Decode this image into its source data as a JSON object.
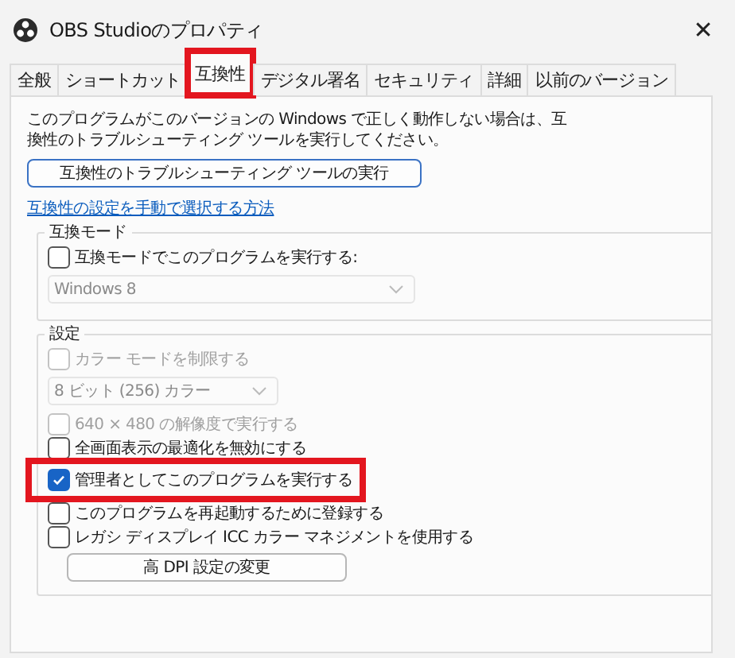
{
  "window": {
    "title": "OBS Studioのプロパティ",
    "close": "✕"
  },
  "tabs": [
    {
      "label": "全般",
      "selected": false,
      "highlighted": false
    },
    {
      "label": "ショートカット",
      "selected": false,
      "highlighted": false
    },
    {
      "label": "互換性",
      "selected": true,
      "highlighted": true
    },
    {
      "label": "デジタル署名",
      "selected": false,
      "highlighted": false
    },
    {
      "label": "セキュリティ",
      "selected": false,
      "highlighted": false
    },
    {
      "label": "詳細",
      "selected": false,
      "highlighted": false
    },
    {
      "label": "以前のバージョン",
      "selected": false,
      "highlighted": false
    }
  ],
  "intro": "このプログラムがこのバージョンの Windows で正しく動作しない場合は、互換性のトラブルシューティング ツールを実行してください。",
  "troubleshoot_button": "互換性のトラブルシューティング ツールの実行",
  "help_link": "互換性の設定を手動で選択する方法",
  "compat_mode": {
    "title": "互換モード",
    "items": [
      {
        "kind": "checkbox",
        "label": "互換モードでこのプログラムを実行する:",
        "checked": false,
        "disabled": false,
        "highlighted": false
      },
      {
        "kind": "dropdown",
        "value": "Windows 8",
        "disabled": true
      }
    ]
  },
  "settings": {
    "title": "設定",
    "items": [
      {
        "kind": "checkbox",
        "label": "カラー モードを制限する",
        "checked": false,
        "disabled": true,
        "highlighted": false
      },
      {
        "kind": "dropdown",
        "value": "8 ビット (256) カラー",
        "disabled": true
      },
      {
        "kind": "checkbox",
        "label": "640 × 480 の解像度で実行する",
        "checked": false,
        "disabled": true,
        "highlighted": false
      },
      {
        "kind": "checkbox",
        "label": "全画面表示の最適化を無効にする",
        "checked": false,
        "disabled": false,
        "highlighted": false
      },
      {
        "kind": "checkbox",
        "label": "管理者としてこのプログラムを実行する",
        "checked": true,
        "disabled": false,
        "highlighted": true
      },
      {
        "kind": "checkbox",
        "label": "このプログラムを再起動するために登録する",
        "checked": false,
        "disabled": false,
        "highlighted": false
      },
      {
        "kind": "checkbox",
        "label": "レガシ ディスプレイ ICC カラー マネジメントを使用する",
        "checked": false,
        "disabled": false,
        "highlighted": false
      },
      {
        "kind": "button",
        "label": "高 DPI 設定の変更"
      }
    ]
  }
}
